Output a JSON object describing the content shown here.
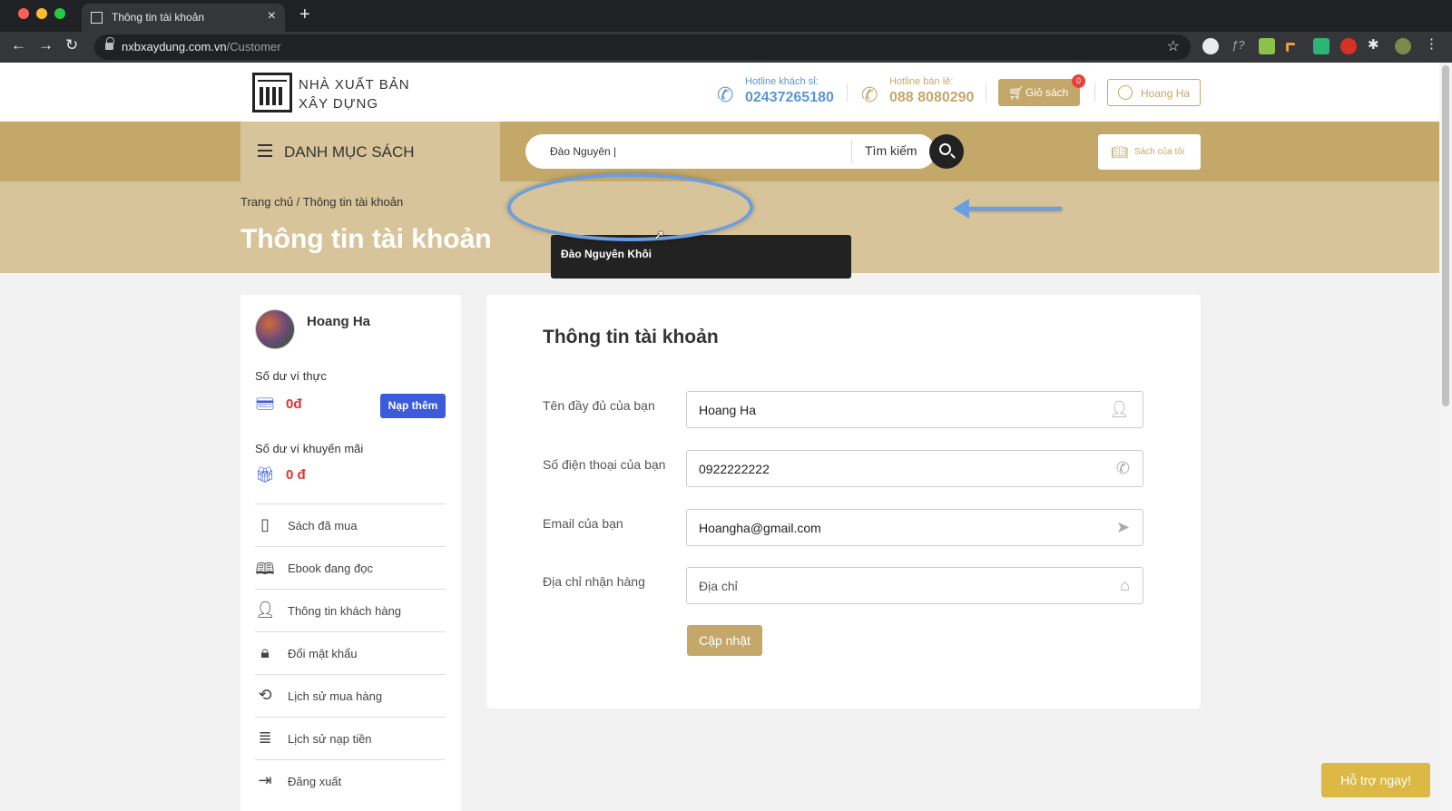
{
  "browser": {
    "tab_title": "Thông tin tài khoản",
    "url_domain": "nxbxaydung.com.vn",
    "url_path": "/Customer"
  },
  "header": {
    "logo_line1": "NHÀ XUẤT BẢN",
    "logo_line2": "XÂY DỰNG",
    "hotline_wholesale_label": "Hotline khách sỉ:",
    "hotline_wholesale_number": "02437265180",
    "hotline_retail_label": "Hotline bán lẻ:",
    "hotline_retail_number": "088 8080290",
    "cart_label": "Giỏ sách",
    "cart_count": "0",
    "user_label": "Hoang Ha"
  },
  "navbar": {
    "category_label": "DANH MỤC SÁCH",
    "search_value": "Đào Nguyên",
    "search_label": "Tìm kiếm",
    "my_books_label": "Sách của tôi",
    "suggestion": "Đào Nguyên Khôi"
  },
  "banner": {
    "breadcrumb": "Trang chủ / Thông tin tài khoản",
    "title": "Thông tin tài khoản"
  },
  "sidebar": {
    "user_name": "Hoang Ha",
    "wallet_label": "Số dư ví thực",
    "wallet_value": "0đ",
    "topup_label": "Nạp thêm",
    "promo_label": "Số dư ví khuyến mãi",
    "promo_value": "0 đ",
    "menu": [
      {
        "label": "Sách đã mua",
        "icon": "book-icon"
      },
      {
        "label": "Ebook đang đọc",
        "icon": "open-book-icon"
      },
      {
        "label": "Thông tin khách hàng",
        "icon": "user-icon"
      },
      {
        "label": "Đổi mật khẩu",
        "icon": "lock-icon"
      },
      {
        "label": "Lịch sử mua hàng",
        "icon": "history-icon"
      },
      {
        "label": "Lịch sử nạp tiền",
        "icon": "coins-icon"
      },
      {
        "label": "Đăng xuất",
        "icon": "logout-icon"
      }
    ]
  },
  "form": {
    "title": "Thông tin tài khoản",
    "fullname_label": "Tên đầy đủ của bạn",
    "fullname_value": "Hoang Ha",
    "phone_label": "Số điện thoại của bạn",
    "phone_value": "0922222222",
    "email_label": "Email của bạn",
    "email_value": "Hoangha@gmail.com",
    "address_label": "Địa chỉ nhận hàng",
    "address_placeholder": "Địa chỉ",
    "update_label": "Cập nhật"
  },
  "support_label": "Hỗ trợ ngay!",
  "colors": {
    "gold": "#c4a86a",
    "light_gold": "#d8c49a",
    "blue_accent": "#3b5bdb",
    "red_value": "#e03131",
    "annotation_blue": "#6b9ee0"
  }
}
